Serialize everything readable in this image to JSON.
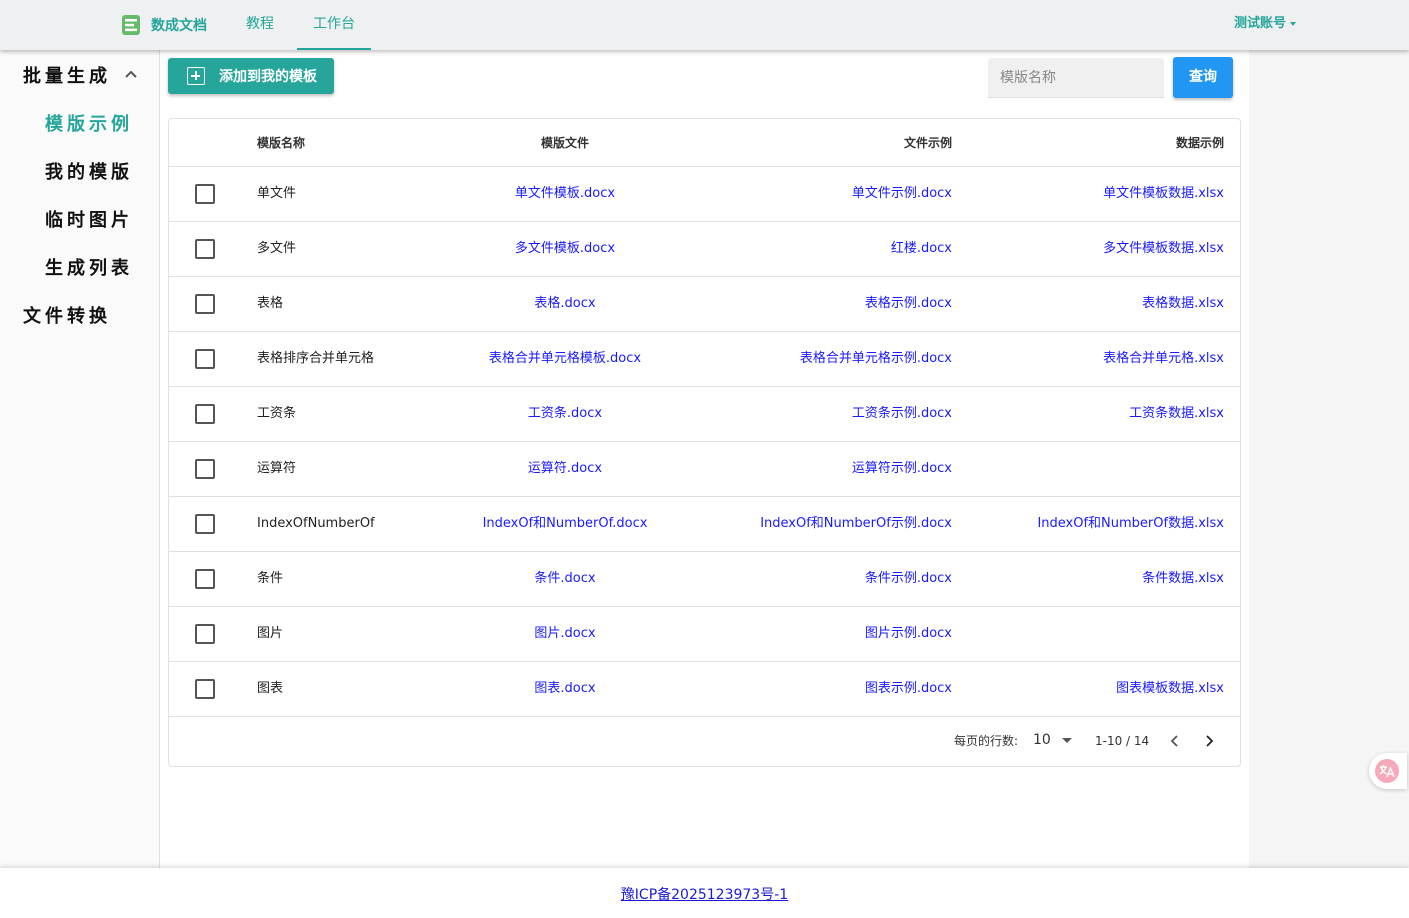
{
  "header": {
    "brand": "数成文档",
    "tabs": [
      {
        "label": "教程"
      },
      {
        "label": "工作台"
      }
    ],
    "account": "测试账号"
  },
  "sidebar": {
    "items": [
      {
        "label": "批量生成"
      },
      {
        "label": "模版示例"
      },
      {
        "label": "我的模版"
      },
      {
        "label": "临时图片"
      },
      {
        "label": "生成列表"
      },
      {
        "label": "文件转换"
      }
    ]
  },
  "toolbar": {
    "add_label": "添加到我的模板",
    "search_placeholder": "模版名称",
    "query_label": "查询"
  },
  "table": {
    "headers": [
      "模版名称",
      "模版文件",
      "文件示例",
      "数据示例"
    ],
    "rows": [
      {
        "name": "单文件",
        "file": "单文件模板.docx",
        "example": "单文件示例.docx",
        "data": "单文件模板数据.xlsx"
      },
      {
        "name": "多文件",
        "file": "多文件模板.docx",
        "example": "红楼.docx",
        "data": "多文件模板数据.xlsx"
      },
      {
        "name": "表格",
        "file": "表格.docx",
        "example": "表格示例.docx",
        "data": "表格数据.xlsx"
      },
      {
        "name": "表格排序合并单元格",
        "file": "表格合并单元格模板.docx",
        "example": "表格合并单元格示例.docx",
        "data": "表格合并单元格.xlsx"
      },
      {
        "name": "工资条",
        "file": "工资条.docx",
        "example": "工资条示例.docx",
        "data": "工资条数据.xlsx"
      },
      {
        "name": "运算符",
        "file": "运算符.docx",
        "example": "运算符示例.docx",
        "data": ""
      },
      {
        "name": "IndexOfNumberOf",
        "file": "IndexOf和NumberOf.docx",
        "example": "IndexOf和NumberOf示例.docx",
        "data": "IndexOf和NumberOf数据.xlsx"
      },
      {
        "name": "条件",
        "file": "条件.docx",
        "example": "条件示例.docx",
        "data": "条件数据.xlsx"
      },
      {
        "name": "图片",
        "file": "图片.docx",
        "example": "图片示例.docx",
        "data": ""
      },
      {
        "name": "图表",
        "file": "图表.docx",
        "example": "图表示例.docx",
        "data": "图表模板数据.xlsx"
      }
    ],
    "pagination": {
      "rows_per_page_label": "每页的行数:",
      "rows_per_page": "10",
      "range": "1-10 / 14"
    }
  },
  "footer": {
    "icp": "豫ICP备2025123973号-1"
  },
  "colors": {
    "accent": "#26a69a",
    "primary": "#2196f3",
    "link": "#1a1aff"
  }
}
